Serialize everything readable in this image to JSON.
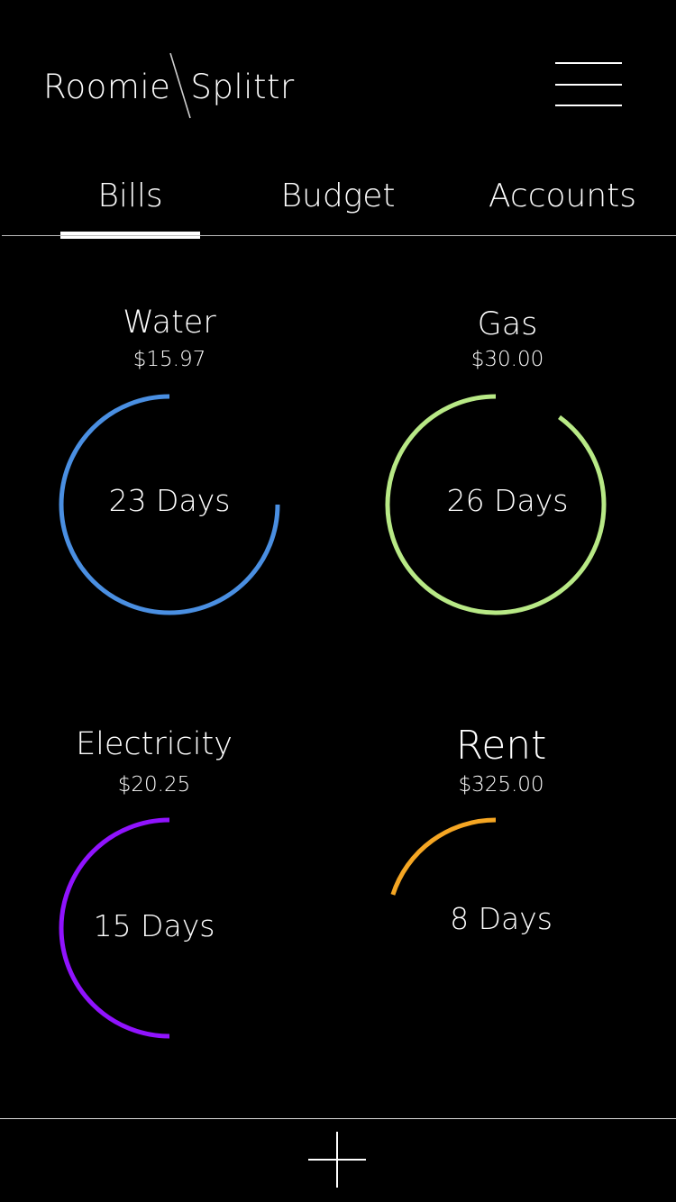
{
  "header": {
    "logo_left": "Roomie",
    "logo_right": "Splittr",
    "menu_icon": "hamburger-menu-icon"
  },
  "tabs": [
    {
      "label": "Bills",
      "active": true
    },
    {
      "label": "Budget",
      "active": false
    },
    {
      "label": "Accounts",
      "active": false
    }
  ],
  "bills": [
    {
      "name": "Water",
      "amount": "$15.97",
      "days": "23 Days",
      "color": "#4A8FE2",
      "progress": 0.75
    },
    {
      "name": "Gas",
      "amount": "$30.00",
      "days": "26 Days",
      "color": "#B8E986",
      "progress": 0.9
    },
    {
      "name": "Electricity",
      "amount": "$20.25",
      "days": "15 Days",
      "color": "#9013FE",
      "progress": 0.5
    },
    {
      "name": "Rent",
      "amount": "$325.00",
      "days": "8 Days",
      "color": "#F5A623",
      "progress": 0.2
    }
  ],
  "footer": {
    "add_icon": "plus-icon"
  }
}
